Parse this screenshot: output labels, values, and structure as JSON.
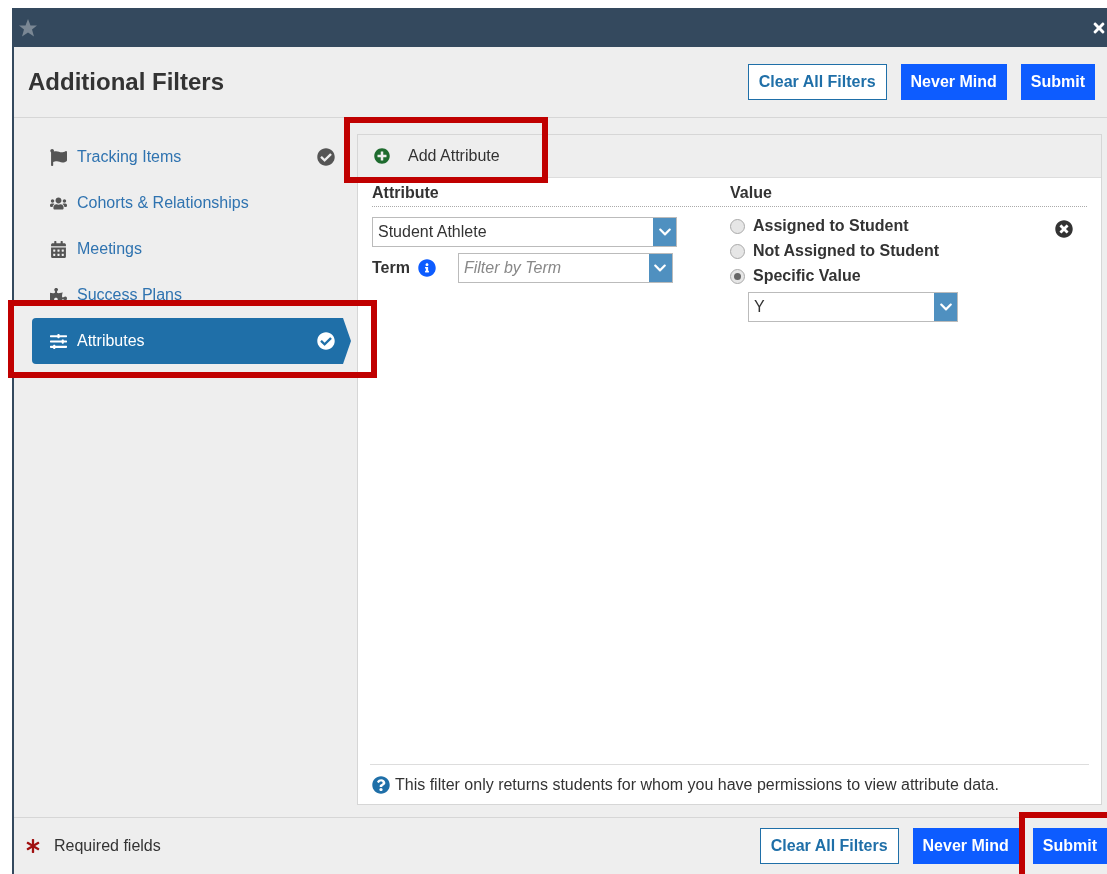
{
  "dialog": {
    "title": "Additional Filters"
  },
  "header_buttons": [
    {
      "label": "Clear All Filters",
      "kind": "outline"
    },
    {
      "label": "Never Mind",
      "kind": "primary"
    },
    {
      "label": "Submit",
      "kind": "primary"
    }
  ],
  "sidebar": {
    "items": [
      {
        "label": "Tracking Items",
        "selected": false,
        "checked": true,
        "highlighted": false
      },
      {
        "label": "Cohorts & Relationships",
        "selected": false,
        "checked": false,
        "highlighted": false
      },
      {
        "label": "Meetings",
        "selected": false,
        "checked": false,
        "highlighted": false
      },
      {
        "label": "Success Plans",
        "selected": false,
        "checked": false,
        "highlighted": false
      },
      {
        "label": "Attributes",
        "selected": true,
        "checked": true,
        "highlighted": true
      }
    ]
  },
  "add_attribute": {
    "label": "Add Attribute",
    "highlighted": true
  },
  "attribute_header": {
    "column_1": "Attribute",
    "column_2": "Value"
  },
  "attribute_select": {
    "value": "Student Athlete"
  },
  "term": {
    "label": "Term",
    "placeholder": "Filter by Term"
  },
  "value_options": [
    {
      "label": "Assigned to Student",
      "selected": false
    },
    {
      "label": "Not Assigned to Student",
      "selected": false
    },
    {
      "label": "Specific Value",
      "selected": true
    }
  ],
  "specific_value_select": {
    "value": "Y"
  },
  "note": "This filter only returns students for whom you have permissions to view attribute data.",
  "footer": {
    "required": "Required fields",
    "buttons": [
      {
        "label": "Clear All Filters",
        "kind": "outline",
        "highlighted": false
      },
      {
        "label": "Never Mind",
        "kind": "primary",
        "highlighted": false
      },
      {
        "label": "Submit",
        "kind": "primary",
        "highlighted": true
      }
    ]
  }
}
